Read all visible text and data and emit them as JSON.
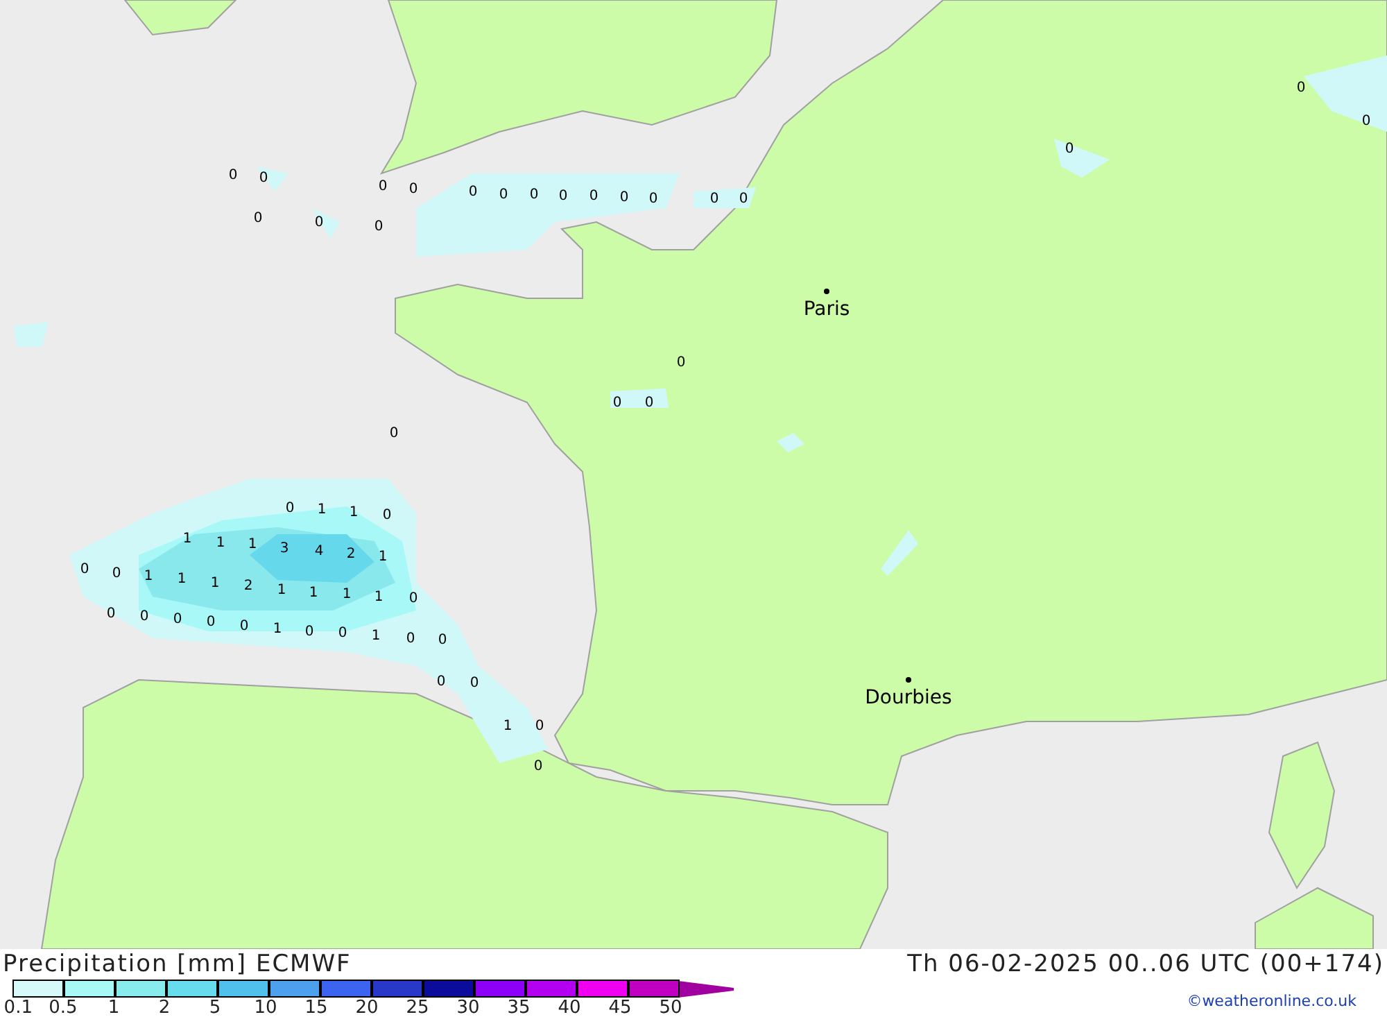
{
  "map": {
    "value_labels": [
      "0",
      "0",
      "0",
      "0",
      "0",
      "0",
      "0",
      "0",
      "0",
      "0",
      "0",
      "0",
      "0",
      "0",
      "0",
      "0",
      "0",
      "0",
      "0",
      "0",
      "0",
      "0",
      "0",
      "0",
      "1",
      "1",
      "0",
      "1",
      "1",
      "1",
      "3",
      "4",
      "2",
      "1",
      "0",
      "0",
      "1",
      "1",
      "1",
      "2",
      "1",
      "1",
      "1",
      "1",
      "0",
      "0",
      "0",
      "0",
      "0",
      "0",
      "1",
      "0",
      "0",
      "1",
      "0",
      "0",
      "0",
      "0",
      "1",
      "0",
      "0"
    ],
    "cities": [
      {
        "name": "Paris"
      },
      {
        "name": "Dourbies"
      }
    ]
  },
  "header": {
    "title": "Precipitation [mm] ECMWF",
    "valid_time": "Th 06-02-2025 00..06 UTC (00+174)"
  },
  "legend": {
    "bins": [
      {
        "color": "#d6fafa"
      },
      {
        "color": "#a8f8f8"
      },
      {
        "color": "#88ecec"
      },
      {
        "color": "#66dcec"
      },
      {
        "color": "#50c0ec"
      },
      {
        "color": "#4ca0ec"
      },
      {
        "color": "#3c64f0"
      },
      {
        "color": "#2838c8"
      },
      {
        "color": "#0c0c9c"
      },
      {
        "color": "#8c00f8"
      },
      {
        "color": "#b400f0"
      },
      {
        "color": "#f000f0"
      },
      {
        "color": "#c000c0"
      }
    ],
    "ticks": [
      "0.1",
      "0.5",
      "1",
      "2",
      "5",
      "10",
      "15",
      "20",
      "25",
      "30",
      "35",
      "40",
      "45",
      "50"
    ]
  },
  "credit": "©weatheronline.co.uk"
}
